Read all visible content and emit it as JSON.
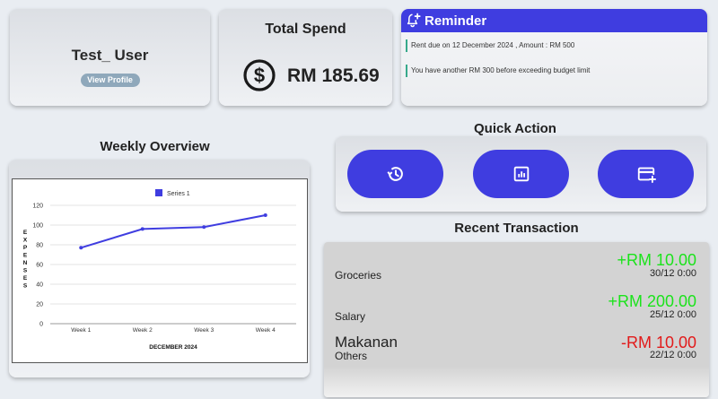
{
  "profile": {
    "username": "Test_ User",
    "view_profile_label": "View Profile"
  },
  "spend": {
    "title": "Total Spend",
    "amount": "RM 185.69",
    "icon": "dollar-circle-icon"
  },
  "reminder": {
    "title": "Reminder",
    "icon": "bell-plus-icon",
    "items": [
      "Rent due on 12 December 2024 , Amount : RM 500",
      "You have another RM 300 before exceeding budget limit"
    ]
  },
  "weekly": {
    "title": "Weekly Overview"
  },
  "quick_action": {
    "title": "Quick Action",
    "buttons": [
      {
        "icon": "history-icon"
      },
      {
        "icon": "report-icon"
      },
      {
        "icon": "add-card-icon"
      }
    ]
  },
  "recent": {
    "title": "Recent Transaction",
    "transactions": [
      {
        "name": "",
        "category": "Groceries",
        "amount": "+RM 10.00",
        "date": "30/12 0:00",
        "type": "income"
      },
      {
        "name": "",
        "category": "Salary",
        "amount": "+RM 200.00",
        "date": "25/12 0:00",
        "type": "income"
      },
      {
        "name": "Makanan",
        "category": "Others",
        "amount": "-RM 10.00",
        "date": "22/12 0:00",
        "type": "expense"
      }
    ]
  },
  "colors": {
    "accent": "#3f3de0",
    "income": "#1be31b",
    "expense": "#e21a1a",
    "reminder_bar": "#37a98b"
  },
  "chart_data": {
    "type": "line",
    "categories": [
      "Week 1",
      "Week 2",
      "Week 3",
      "Week 4"
    ],
    "series": [
      {
        "name": "Series 1",
        "values": [
          77,
          96,
          98,
          110
        ]
      }
    ],
    "xlabel": "DECEMBER 2024",
    "ylabel": "EXPENSES",
    "ylim": [
      0,
      120
    ],
    "yticks": [
      0,
      20,
      40,
      60,
      80,
      100,
      120
    ],
    "grid": true,
    "legend": "top-center",
    "color": "#3f3de0"
  }
}
